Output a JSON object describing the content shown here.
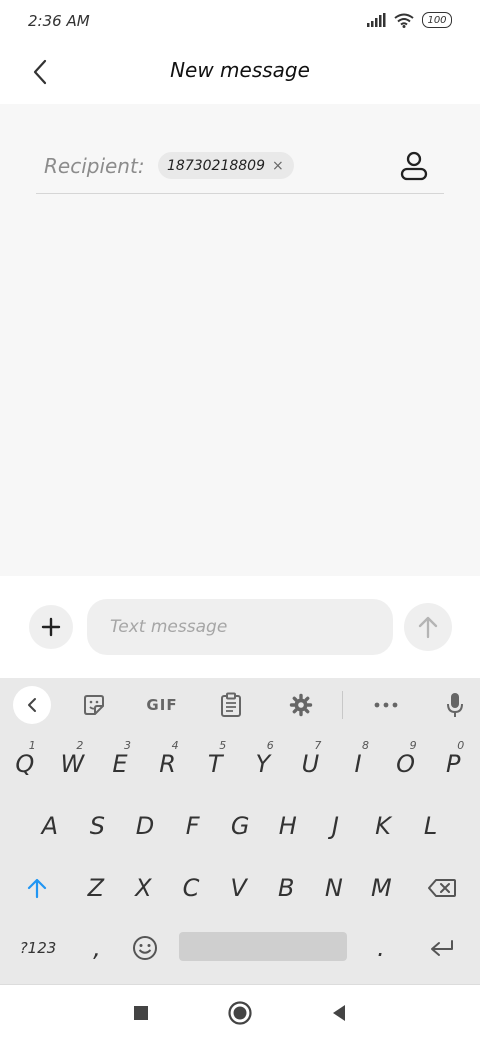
{
  "status_bar": {
    "time": "2:36 AM",
    "battery": "100"
  },
  "header": {
    "title": "New message"
  },
  "recipient": {
    "label": "Recipient:",
    "chip": "18730218809",
    "chip_close": "×"
  },
  "compose": {
    "placeholder": "Text message",
    "value": ""
  },
  "keyboard": {
    "toolbar": {
      "gif_label": "GIF"
    },
    "row1": [
      {
        "key": "Q",
        "num": "1"
      },
      {
        "key": "W",
        "num": "2"
      },
      {
        "key": "E",
        "num": "3"
      },
      {
        "key": "R",
        "num": "4"
      },
      {
        "key": "T",
        "num": "5"
      },
      {
        "key": "Y",
        "num": "6"
      },
      {
        "key": "U",
        "num": "7"
      },
      {
        "key": "I",
        "num": "8"
      },
      {
        "key": "O",
        "num": "9"
      },
      {
        "key": "P",
        "num": "0"
      }
    ],
    "row2": [
      "A",
      "S",
      "D",
      "F",
      "G",
      "H",
      "J",
      "K",
      "L"
    ],
    "row3": [
      "Z",
      "X",
      "C",
      "V",
      "B",
      "N",
      "M"
    ],
    "symbols_label": "?123",
    "comma": ",",
    "period": "."
  },
  "colors": {
    "shift_active": "#2196f3",
    "content_bg": "#f7f7f7",
    "keyboard_bg": "#e9e9e9"
  }
}
